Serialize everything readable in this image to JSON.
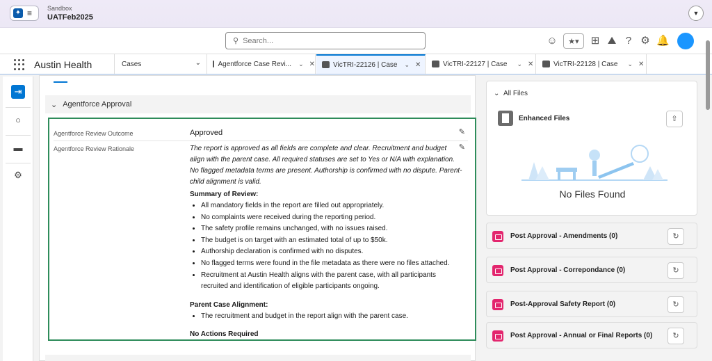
{
  "org": {
    "subtitle": "Sandbox",
    "name": "UATFeb2025"
  },
  "search": {
    "placeholder": "Search..."
  },
  "nav": {
    "app_name": "Austin Health",
    "object_selector": "Cases",
    "tabs": [
      {
        "label": "Agentforce Case Revi...",
        "active": false
      },
      {
        "label": "VicTRI-22126 | Case",
        "active": true
      },
      {
        "label": "VicTRI-22127 | Case",
        "active": false
      },
      {
        "label": "VicTRI-22128 | Case",
        "active": false
      }
    ]
  },
  "section": {
    "title": "Agentforce Approval"
  },
  "fields": {
    "outcome": {
      "label": "Agentforce Review Outcome",
      "value": "Approved"
    },
    "rationale": {
      "label": "Agentforce Review Rationale",
      "intro": "The report is approved as all fields are complete and clear. Recruitment and budget align with the parent case. All required statuses are set to Yes or N/A with explanation. No flagged metadata terms are present. Authorship is confirmed with no dispute. Parent-child alignment is valid.",
      "summary_heading": "Summary of Review:",
      "summary_items": [
        "All mandatory fields in the report are filled out appropriately.",
        "No complaints were received during the reporting period.",
        "The safety profile remains unchanged, with no issues raised.",
        "The budget is on target with an estimated total of up to $50k.",
        "Authorship declaration is confirmed with no disputes.",
        "No flagged terms were found in the file metadata as there were no files attached.",
        "Recruitment at Austin Health aligns with the parent case, with all participants recruited and identification of eligible participants ongoing."
      ],
      "parent_heading": "Parent Case Alignment:",
      "parent_items": [
        "The recruitment and budget in the report align with the parent case."
      ],
      "actions_heading": "No Actions Required"
    }
  },
  "files": {
    "all_files": "All Files",
    "enhanced_files": "Enhanced Files",
    "empty_text": "No Files Found"
  },
  "related_lists": [
    "Post Approval - Amendments (0)",
    "Post Approval - Correpondance (0)",
    "Post-Approval Safety Report (0)",
    "Post Approval - Annual or Final Reports (0)"
  ]
}
